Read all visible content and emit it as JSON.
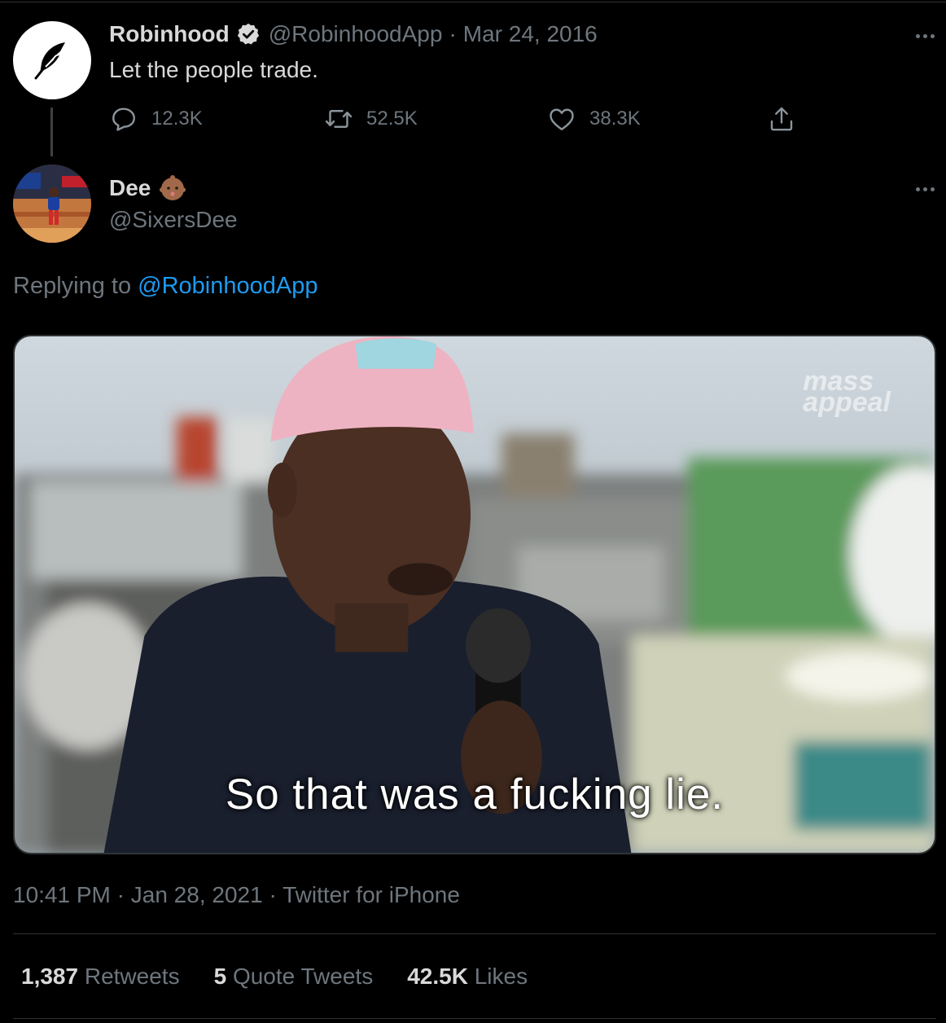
{
  "parent_tweet": {
    "display_name": "Robinhood",
    "handle": "@RobinhoodApp",
    "date": "Mar 24, 2016",
    "separator": "·",
    "text": "Let the people trade.",
    "avatar_icon": "feather-icon",
    "actions": {
      "reply_count": "12.3K",
      "retweet_count": "52.5K",
      "like_count": "38.3K"
    }
  },
  "reply_tweet": {
    "display_name": "Dee",
    "handle": "@SixersDee",
    "name_emoji": "baby-emoji",
    "replying_prefix": "Replying to ",
    "replying_to": "@RobinhoodApp",
    "media": {
      "subtitle": "So that was a fucking lie.",
      "watermark_line1": "mass",
      "watermark_line2": "appeal"
    },
    "time": "10:41 PM",
    "date": "Jan 28, 2021",
    "source": "Twitter for iPhone",
    "separator": "·",
    "stats": {
      "retweets_num": "1,387",
      "retweets_label": "Retweets",
      "quotes_num": "5",
      "quotes_label": "Quote Tweets",
      "likes_num": "42.5K",
      "likes_label": "Likes"
    }
  },
  "colors": {
    "background": "#000000",
    "text": "#d9d9d9",
    "muted": "#6e767d",
    "link": "#1d9bf0",
    "verified": "#d9d9d9"
  }
}
